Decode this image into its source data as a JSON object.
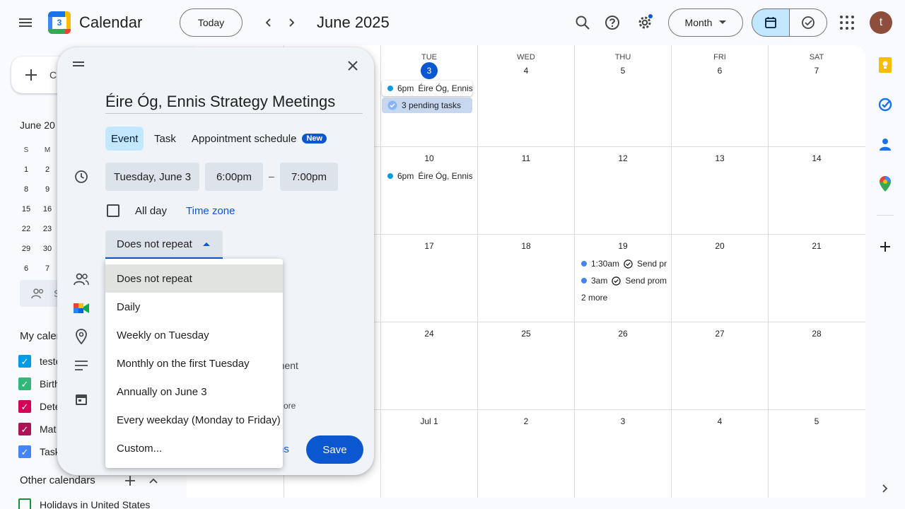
{
  "header": {
    "app_title": "Calendar",
    "logo_text": "3",
    "today_label": "Today",
    "prev_icon": "chevron-left-icon",
    "next_icon": "chevron-right-icon",
    "month_title": "June 2025",
    "view_label": "Month",
    "avatar_initial": "t"
  },
  "sidebar": {
    "create_label": "Cr",
    "mini_title": "June 20",
    "weekday_initials": [
      "S",
      "M"
    ],
    "mini_rows": [
      [
        "1",
        "2"
      ],
      [
        "8",
        "9"
      ],
      [
        "15",
        "16"
      ],
      [
        "22",
        "23"
      ],
      [
        "29",
        "30"
      ],
      [
        "6",
        "7"
      ]
    ],
    "search_people": "S",
    "my_calendars_title": "My calen",
    "calendars": [
      {
        "label": "teste",
        "color": "#039be5"
      },
      {
        "label": "Birth",
        "color": "#33b679"
      },
      {
        "label": "Dete",
        "color": "#d50057"
      },
      {
        "label": "Mat",
        "color": "#ad1457"
      },
      {
        "label": "Task",
        "color": "#4285f4"
      }
    ],
    "other_calendars_title": "Other calendars",
    "holiday_calendar": "Holidays in United States"
  },
  "grid": {
    "weekdays": [
      "TUE",
      "WED",
      "THU",
      "FRI",
      "SAT"
    ],
    "weeks": [
      [
        "3",
        "4",
        "5",
        "6",
        "7"
      ],
      [
        "10",
        "11",
        "12",
        "13",
        "14"
      ],
      [
        "17",
        "18",
        "19",
        "20",
        "21"
      ],
      [
        "24",
        "25",
        "26",
        "27",
        "28"
      ],
      [
        "Jul 1",
        "2",
        "3",
        "4",
        "5"
      ]
    ],
    "events": {
      "jun3_event_time": "6pm",
      "jun3_event_title": "Éire Óg, Ennis",
      "jun3_tasks": "3 pending tasks",
      "jun10_event_time": "6pm",
      "jun10_event_title": "Éire Óg, Ennis",
      "jun19_task1_time": "1:30am",
      "jun19_task1_title": "Send pr",
      "jun19_task2_time": "3am",
      "jun19_task2_title": "Send prom",
      "jun19_more": "2 more"
    }
  },
  "dialog": {
    "title_value": "Éire Óg, Ennis Strategy Meetings",
    "tabs": [
      "Event",
      "Task",
      "Appointment schedule"
    ],
    "new_badge": "New",
    "date": "Tuesday, June 3",
    "start_time": "6:00pm",
    "dash": "–",
    "end_time": "7:00pm",
    "all_day_label": "All day",
    "time_zone_label": "Time zone",
    "repeat_value": "Does not repeat",
    "peek_attachment": "hment",
    "peek_more": "ore",
    "more_options_peek": "ns",
    "save_label": "Save"
  },
  "repeat_menu": {
    "options": [
      "Does not repeat",
      "Daily",
      "Weekly on Tuesday",
      "Monthly on the first Tuesday",
      "Annually on June 3",
      "Every weekday (Monday to Friday)",
      "Custom..."
    ],
    "selected_index": 0
  },
  "colors": {
    "accent": "#0b57d0",
    "event_dot": "#039be5",
    "selected_view_bg": "#c2e7ff"
  }
}
